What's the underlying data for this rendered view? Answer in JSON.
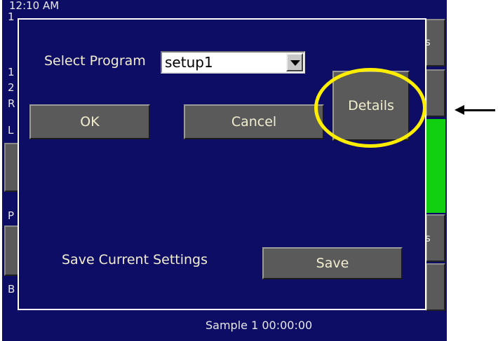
{
  "background": {
    "clock_fragment": "12:10 AM",
    "edge_chars": [
      "1",
      "1",
      "2",
      "R",
      "L",
      "P",
      "B",
      "s",
      "s"
    ]
  },
  "dialog": {
    "select_program_label": "Select Program",
    "program_select_value": "setup1",
    "ok_button": "OK",
    "cancel_button": "Cancel",
    "details_button": "Details",
    "save_settings_label": "Save Current Settings",
    "save_button": "Save"
  },
  "status_bar": {
    "text": "Sample  1  00:00:00"
  },
  "colors": {
    "screen_bg": "#0d0d66",
    "button_gray": "#5a5a5a",
    "label_text": "#f2eecf",
    "highlight": "#ffee00",
    "indicator_green": "#10d010"
  }
}
